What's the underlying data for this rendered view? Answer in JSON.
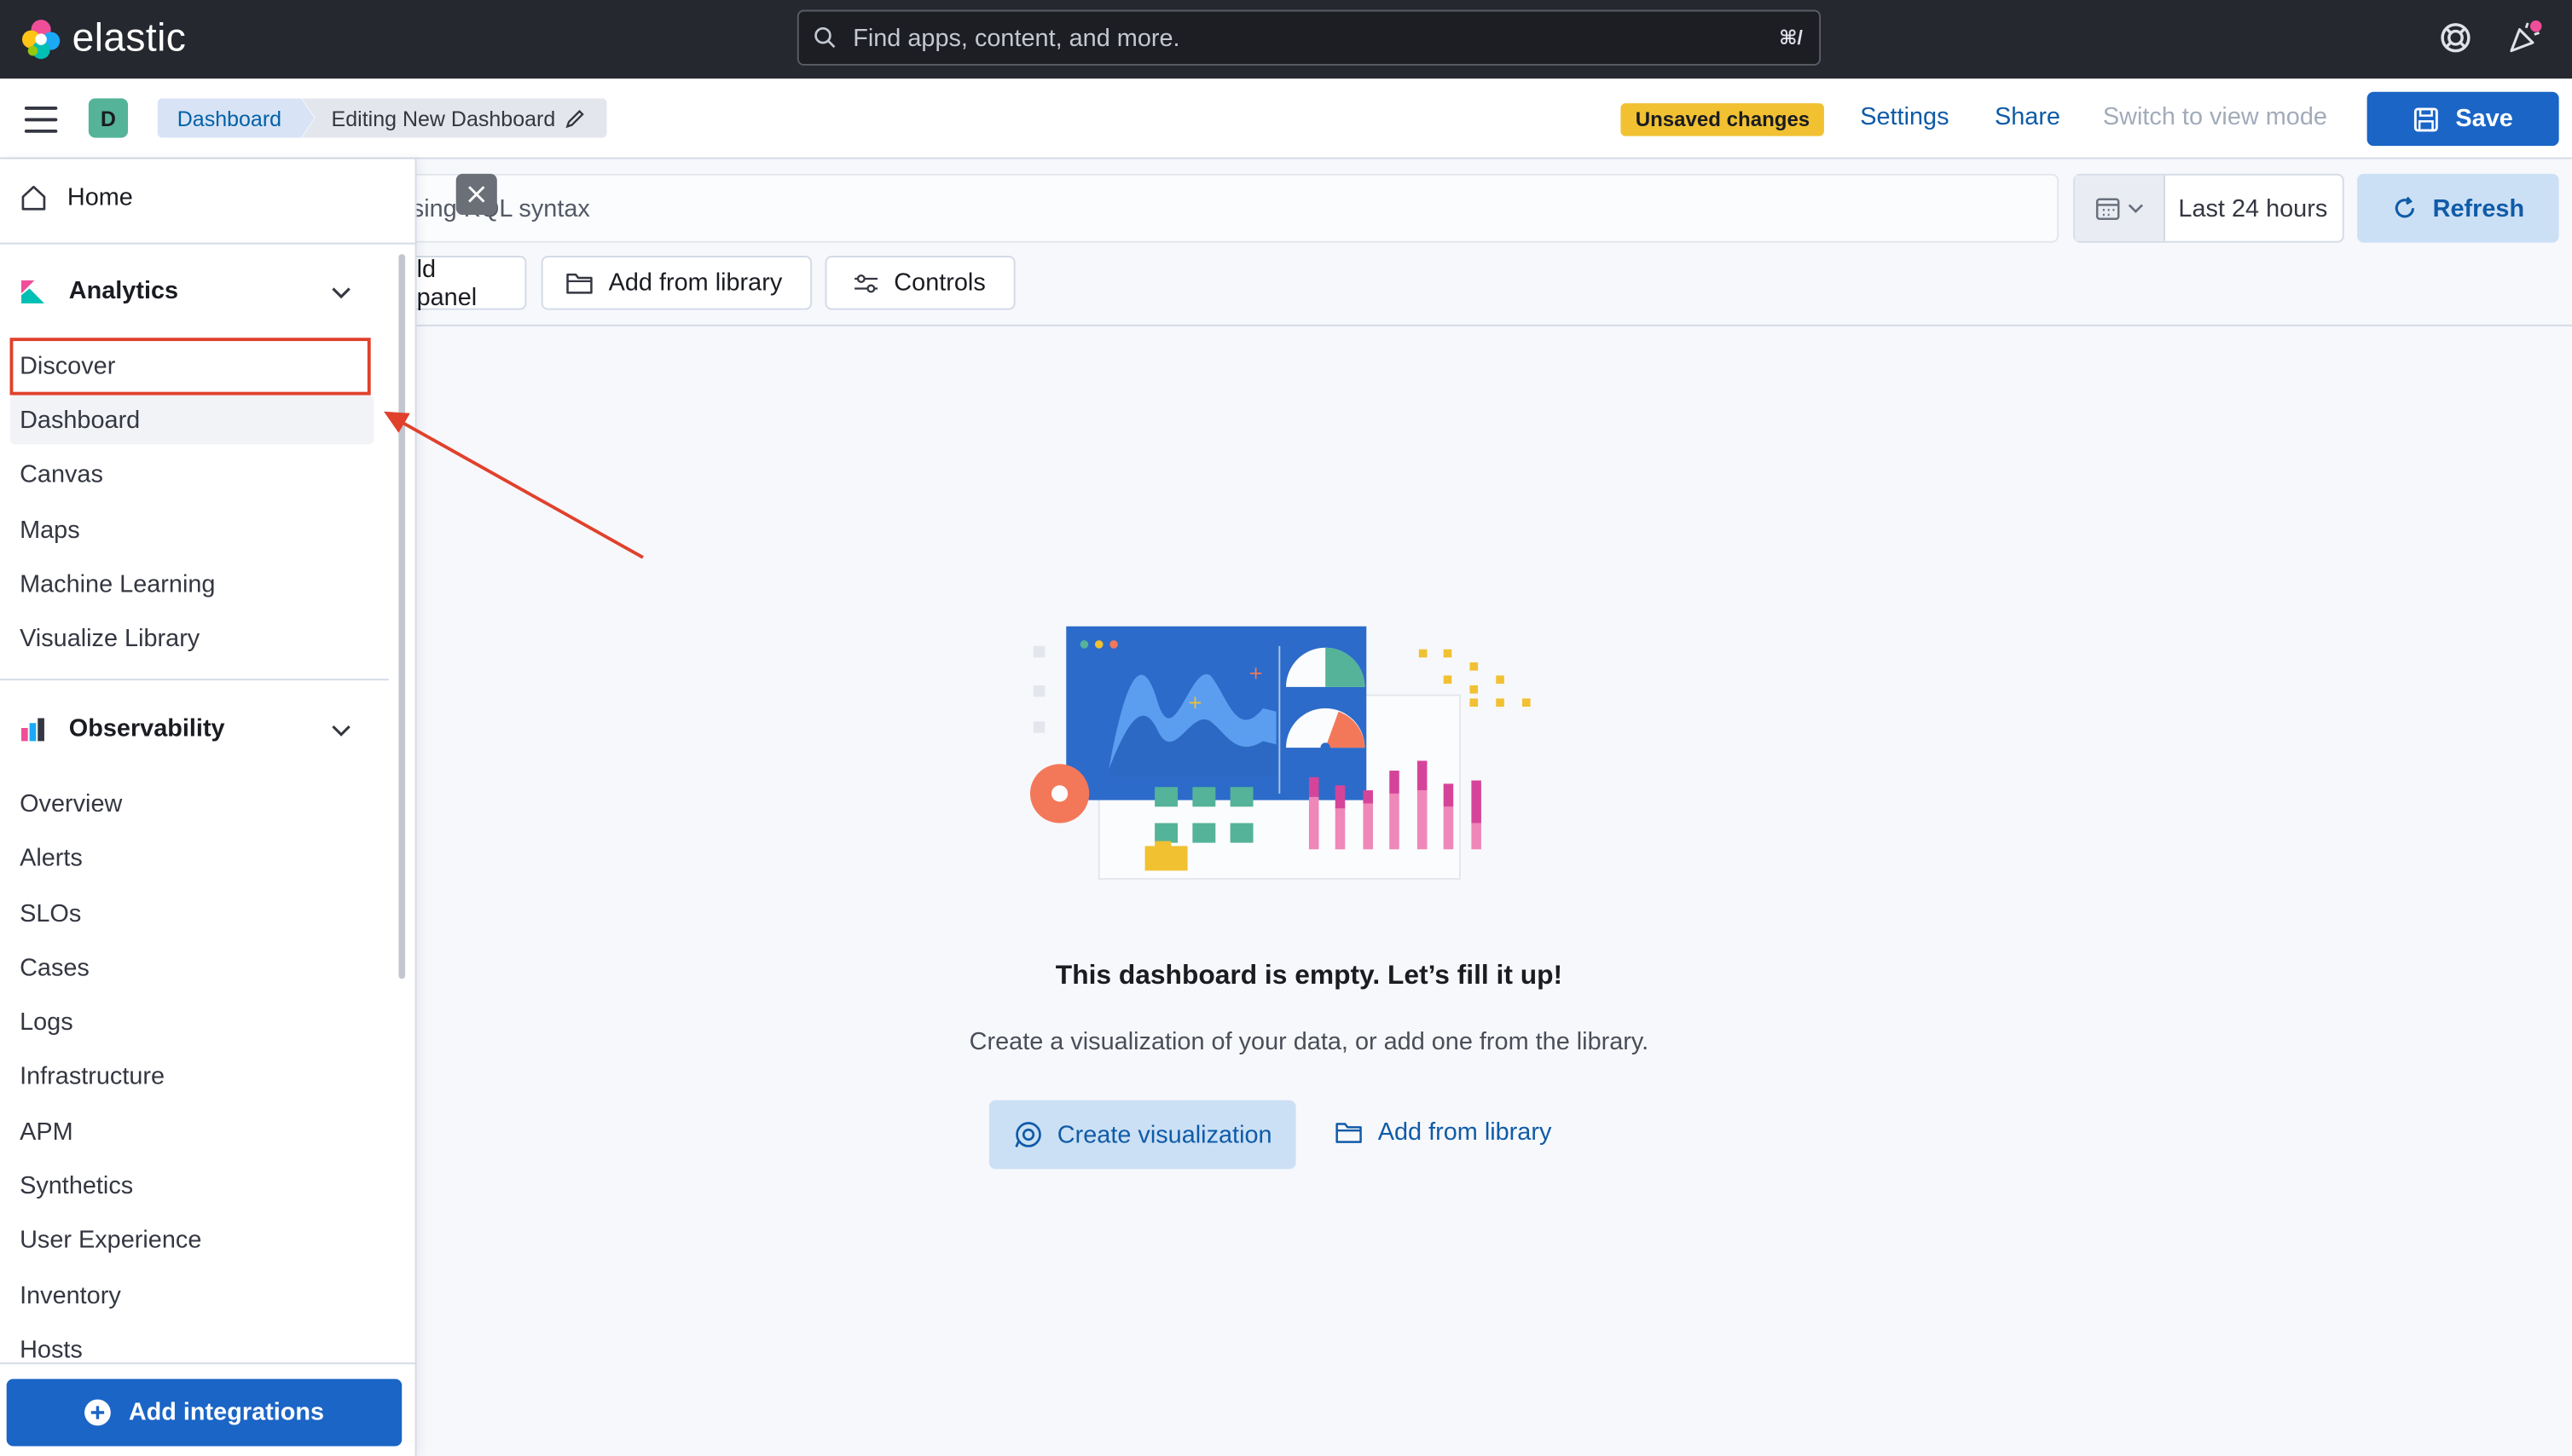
{
  "header": {
    "brand": "elastic",
    "search_placeholder": "Find apps, content, and more.",
    "search_shortcut": "⌘/"
  },
  "appbar": {
    "space_initial": "D",
    "breadcrumbs": [
      "Dashboard",
      "Editing New Dashboard"
    ],
    "unsaved_label": "Unsaved changes",
    "settings_label": "Settings",
    "share_label": "Share",
    "view_mode_label": "Switch to view mode",
    "save_label": "Save"
  },
  "query": {
    "placeholder_visible": "sing KQL syntax",
    "date_label": "Last 24 hours",
    "refresh_label": "Refresh"
  },
  "panel_toolbar": {
    "add_panel_label": "ld panel",
    "add_from_library_label": "Add from library",
    "controls_label": "Controls"
  },
  "empty_state": {
    "title": "This dashboard is empty. Let’s fill it up!",
    "body": "Create a visualization of your data, or add one from the library.",
    "create_label": "Create visualization",
    "add_library_label": "Add from library"
  },
  "sidenav": {
    "home_label": "Home",
    "analytics": {
      "title": "Analytics",
      "items": [
        "Discover",
        "Dashboard",
        "Canvas",
        "Maps",
        "Machine Learning",
        "Visualize Library"
      ]
    },
    "observability": {
      "title": "Observability",
      "items": [
        "Overview",
        "Alerts",
        "SLOs",
        "Cases",
        "Logs",
        "Infrastructure",
        "APM",
        "Synthetics",
        "User Experience",
        "Inventory",
        "Hosts"
      ]
    },
    "add_integrations_label": "Add integrations"
  },
  "colors": {
    "header_bg": "#25282f",
    "primary": "#1a65c6",
    "link": "#0f5ba7",
    "unsaved_badge": "#f1c132",
    "annotation": "#e0412c"
  }
}
